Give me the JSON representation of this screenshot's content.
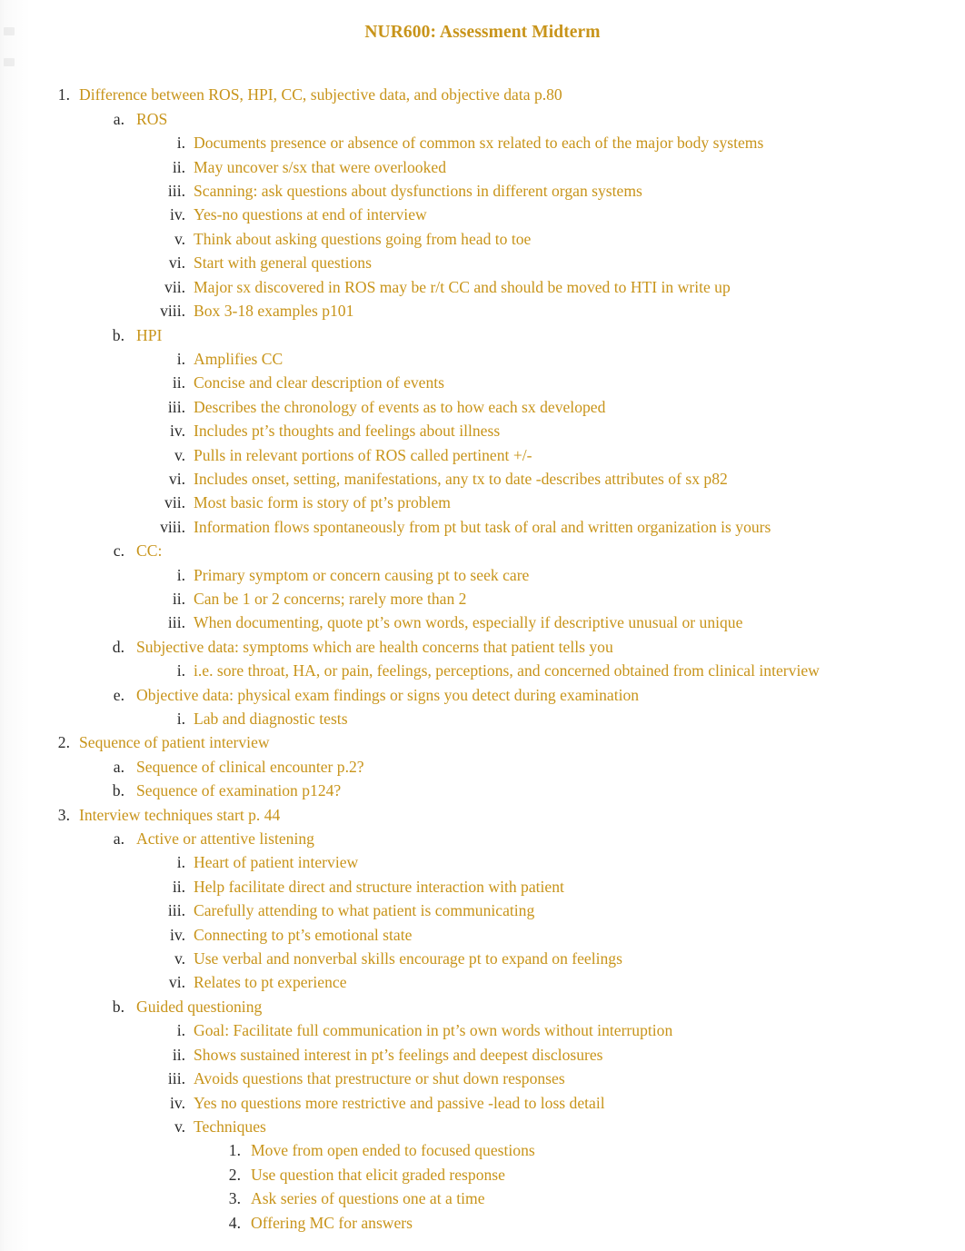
{
  "document": {
    "title": "NUR600: Assessment Midterm",
    "text_color": "#c8941a",
    "marker_color": "#2b2b2b",
    "background_color": "#ffffff"
  },
  "outline": [
    {
      "level": 1,
      "marker": "1.",
      "text": "Difference between ROS, HPI, CC, subjective data, and objective data p.80"
    },
    {
      "level": 2,
      "marker": "a.",
      "text": "ROS"
    },
    {
      "level": 3,
      "marker": "i.",
      "text": "Documents presence or absence of common sx related to each of the major body systems"
    },
    {
      "level": 3,
      "marker": "ii.",
      "text": "May uncover s/sx that were overlooked"
    },
    {
      "level": 3,
      "marker": "iii.",
      "text": "Scanning: ask questions about dysfunctions in different organ systems"
    },
    {
      "level": 3,
      "marker": "iv.",
      "text": "Yes-no questions at end of interview"
    },
    {
      "level": 3,
      "marker": "v.",
      "text": "Think about asking questions going from head to toe"
    },
    {
      "level": 3,
      "marker": "vi.",
      "text": "Start with general questions"
    },
    {
      "level": 3,
      "marker": "vii.",
      "text": "Major sx discovered in ROS may be r/t CC and should be moved to HTI in write up"
    },
    {
      "level": 3,
      "marker": "viii.",
      "text": "Box 3-18 examples p101"
    },
    {
      "level": 2,
      "marker": "b.",
      "text": "HPI"
    },
    {
      "level": 3,
      "marker": "i.",
      "text": "Amplifies CC"
    },
    {
      "level": 3,
      "marker": "ii.",
      "text": "Concise and clear description of events"
    },
    {
      "level": 3,
      "marker": "iii.",
      "text": "Describes the chronology of events as to how each sx developed"
    },
    {
      "level": 3,
      "marker": "iv.",
      "text": "Includes pt’s thoughts and feelings about illness"
    },
    {
      "level": 3,
      "marker": "v.",
      "text": "Pulls in relevant portions of ROS called pertinent +/-"
    },
    {
      "level": 3,
      "marker": "vi.",
      "text": "Includes onset, setting, manifestations, any tx to date -describes attributes of sx p82"
    },
    {
      "level": 3,
      "marker": "vii.",
      "text": "Most basic form is story of pt’s problem"
    },
    {
      "level": 3,
      "marker": "viii.",
      "text": "Information flows spontaneously from pt but task of oral and written organization is yours"
    },
    {
      "level": 2,
      "marker": "c.",
      "text": "CC:"
    },
    {
      "level": 3,
      "marker": "i.",
      "text": "Primary symptom or concern causing pt to seek care"
    },
    {
      "level": 3,
      "marker": "ii.",
      "text": "Can be 1 or 2 concerns; rarely more than 2"
    },
    {
      "level": 3,
      "marker": "iii.",
      "text": "When documenting, quote pt’s own words, especially if descriptive unusual or unique"
    },
    {
      "level": 2,
      "marker": "d.",
      "text": "Subjective data: symptoms which are health concerns that patient tells you"
    },
    {
      "level": 3,
      "marker": "i.",
      "text": "i.e. sore throat, HA, or pain, feelings, perceptions, and concerned obtained from clinical interview"
    },
    {
      "level": 2,
      "marker": "e.",
      "text": "Objective data: physical exam findings or signs you detect during examination"
    },
    {
      "level": 3,
      "marker": "i.",
      "text": "Lab and diagnostic tests"
    },
    {
      "level": 1,
      "marker": "2.",
      "text": "Sequence of patient interview"
    },
    {
      "level": 2,
      "marker": "a.",
      "text": "Sequence of clinical encounter p.2?"
    },
    {
      "level": 2,
      "marker": "b.",
      "text": "Sequence of examination p124?"
    },
    {
      "level": 1,
      "marker": "3.",
      "text": "Interview techniques start p. 44"
    },
    {
      "level": 2,
      "marker": "a.",
      "text": "Active or attentive listening"
    },
    {
      "level": 3,
      "marker": "i.",
      "text": "Heart of patient interview"
    },
    {
      "level": 3,
      "marker": "ii.",
      "text": "Help facilitate direct and structure interaction with patient"
    },
    {
      "level": 3,
      "marker": "iii.",
      "text": "Carefully attending to what patient is communicating"
    },
    {
      "level": 3,
      "marker": "iv.",
      "text": "Connecting to pt’s emotional state"
    },
    {
      "level": 3,
      "marker": "v.",
      "text": "Use verbal and nonverbal skills encourage pt to expand on feelings"
    },
    {
      "level": 3,
      "marker": "vi.",
      "text": "Relates to pt experience"
    },
    {
      "level": 2,
      "marker": "b.",
      "text": "Guided questioning"
    },
    {
      "level": 3,
      "marker": "i.",
      "text": "Goal: Facilitate full communication in pt’s own words without interruption"
    },
    {
      "level": 3,
      "marker": "ii.",
      "text": "Shows sustained interest in pt’s feelings and deepest disclosures"
    },
    {
      "level": 3,
      "marker": "iii.",
      "text": "Avoids questions that prestructure or shut down responses"
    },
    {
      "level": 3,
      "marker": "iv.",
      "text": "Yes no questions more restrictive and passive -lead to loss detail"
    },
    {
      "level": 3,
      "marker": "v.",
      "text": "Techniques"
    },
    {
      "level": 4,
      "marker": "1.",
      "text": "Move from open ended to focused questions"
    },
    {
      "level": 4,
      "marker": "2.",
      "text": "Use question that elicit graded response"
    },
    {
      "level": 4,
      "marker": "3.",
      "text": "Ask series of questions one at a time"
    },
    {
      "level": 4,
      "marker": "4.",
      "text": "Offering MC for answers"
    }
  ]
}
